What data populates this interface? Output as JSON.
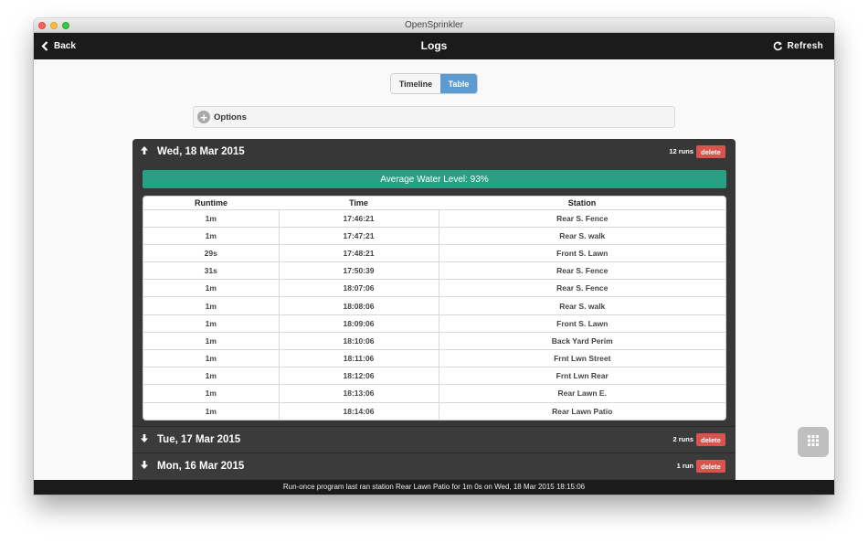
{
  "window": {
    "title": "OpenSprinkler"
  },
  "header": {
    "back_label": "Back",
    "title": "Logs",
    "refresh_label": "Refresh"
  },
  "view_toggle": {
    "options": [
      "Timeline",
      "Table"
    ],
    "selected": "Table"
  },
  "options": {
    "label": "Options"
  },
  "days": [
    {
      "label": "Wed, 18 Mar 2015",
      "runs": "12 runs",
      "delete_label": "delete",
      "expanded": true,
      "water_level": "Average Water Level: 93%",
      "columns": [
        "Runtime",
        "Time",
        "Station"
      ],
      "rows": [
        [
          "1m",
          "17:46:21",
          "Rear S. Fence"
        ],
        [
          "1m",
          "17:47:21",
          "Rear S. walk"
        ],
        [
          "29s",
          "17:48:21",
          "Front S. Lawn"
        ],
        [
          "31s",
          "17:50:39",
          "Rear S. Fence"
        ],
        [
          "1m",
          "18:07:06",
          "Rear S. Fence"
        ],
        [
          "1m",
          "18:08:06",
          "Rear S. walk"
        ],
        [
          "1m",
          "18:09:06",
          "Front S. Lawn"
        ],
        [
          "1m",
          "18:10:06",
          "Back Yard Perim"
        ],
        [
          "1m",
          "18:11:06",
          "Frnt Lwn Street"
        ],
        [
          "1m",
          "18:12:06",
          "Frnt Lwn Rear"
        ],
        [
          "1m",
          "18:13:06",
          "Rear Lawn E."
        ],
        [
          "1m",
          "18:14:06",
          "Rear Lawn Patio"
        ]
      ]
    },
    {
      "label": "Tue, 17 Mar 2015",
      "runs": "2 runs",
      "delete_label": "delete",
      "expanded": false
    },
    {
      "label": "Mon, 16 Mar 2015",
      "runs": "1 run",
      "delete_label": "delete",
      "expanded": false
    }
  ],
  "footer": {
    "status": "Run-once program last ran station Rear Lawn Patio for 1m 0s on Wed, 18 Mar 2015 18:15:06"
  },
  "colors": {
    "header_bg": "#1b1b1b",
    "selected_tab": "#5b9bd1",
    "water_bar": "#27a084",
    "delete_btn": "#d9534f"
  },
  "icons": {
    "back": "chevron-left-icon",
    "refresh": "refresh-icon",
    "options": "plus-circle-icon",
    "grid": "grid-icon"
  }
}
